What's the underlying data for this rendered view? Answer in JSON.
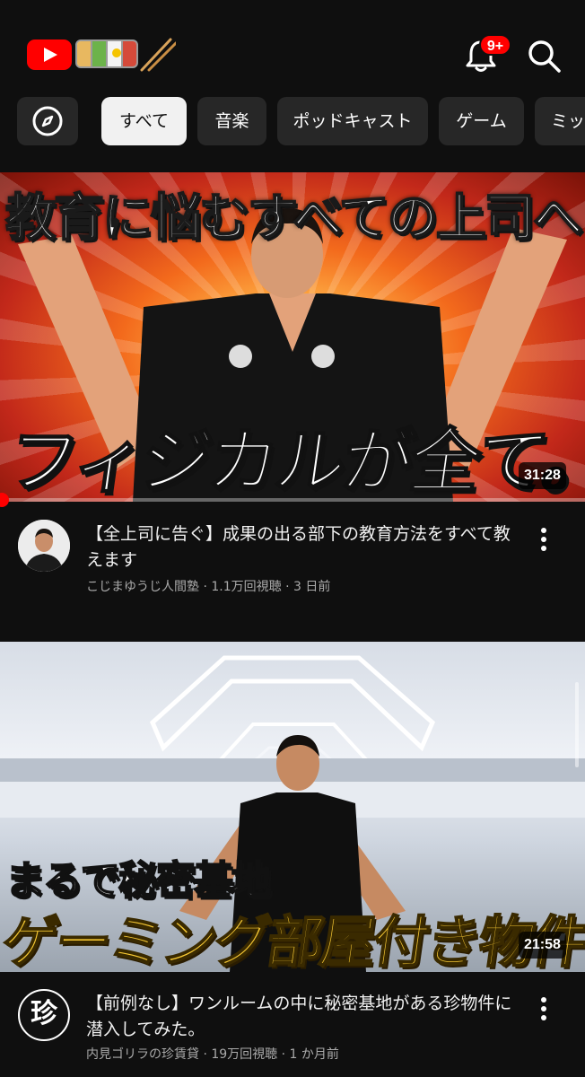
{
  "header": {
    "logo_name": "YouTube",
    "notifications_badge": "9+"
  },
  "chips": {
    "explore_icon": "compass-icon",
    "items": [
      {
        "label": "すべて",
        "selected": true
      },
      {
        "label": "音楽",
        "selected": false
      },
      {
        "label": "ポッドキャスト",
        "selected": false
      },
      {
        "label": "ゲーム",
        "selected": false
      },
      {
        "label": "ミッ",
        "selected": false
      }
    ]
  },
  "videos": [
    {
      "thumb_top_text": "教育に悩むすべての上司へ",
      "thumb_bottom_text": "フィジカルが全て。",
      "duration": "31:28",
      "watch_progress": 0.01,
      "title": "【全上司に告ぐ】成果の出る部下の教育方法をすべて教えます",
      "channel": "こじまゆうじ人間塾",
      "views": "1.1万回視聴",
      "age": "3 日前"
    },
    {
      "thumb_top_text": "まるで秘密基地",
      "thumb_bottom_text": "ゲーミング部屋付き物件",
      "duration": "21:58",
      "title": "【前例なし】ワンルームの中に秘密基地がある珍物件に潜入してみた。",
      "channel": "内見ゴリラの珍賃貸",
      "views": "19万回視聴",
      "age": "1 か月前",
      "avatar_text": "珍"
    }
  ],
  "colors": {
    "background": "#0f0f0f",
    "chip": "#272727",
    "chip_selected": "#f1f1f1",
    "brand_red": "#ff0000",
    "secondary_text": "#aaaaaa"
  }
}
